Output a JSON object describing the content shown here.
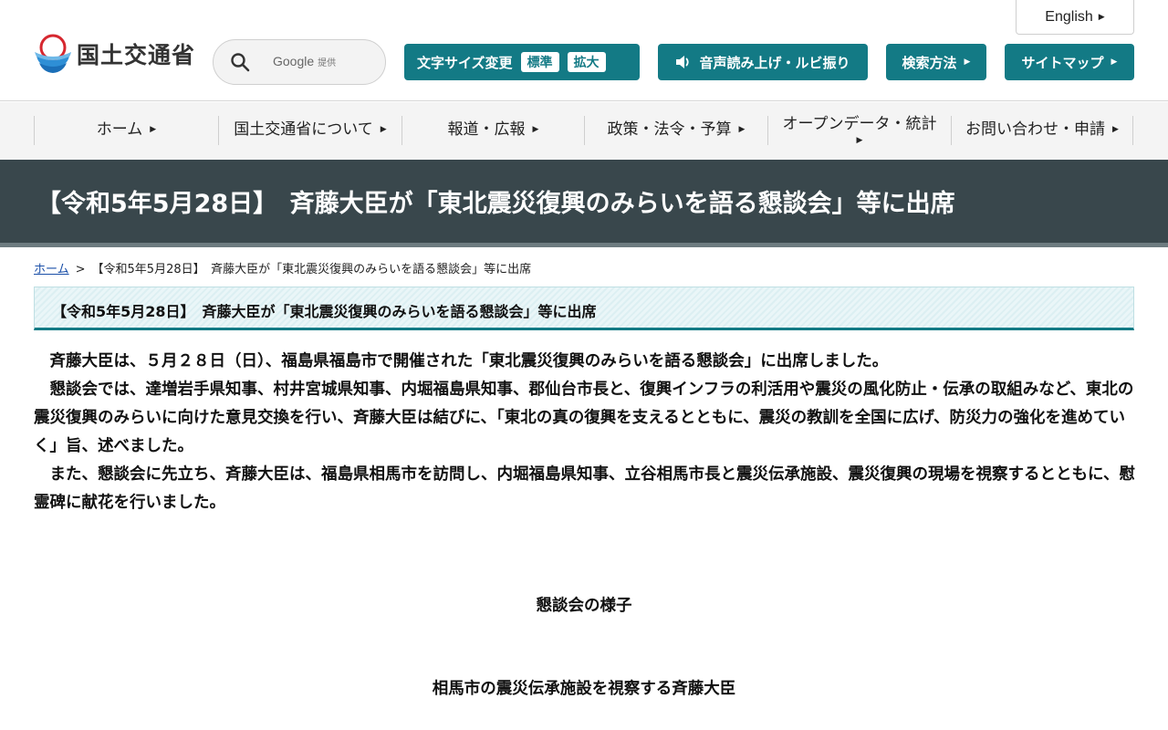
{
  "header": {
    "logo_text": "国土交通省",
    "search": {
      "provider": "Google",
      "provider_suffix": "提供"
    },
    "english_label": "English",
    "font_size": {
      "label": "文字サイズ変更",
      "standard": "標準",
      "large": "拡大"
    },
    "speech_label": "音声読み上げ・ルビ振り",
    "search_method_label": "検索方法",
    "sitemap_label": "サイトマップ"
  },
  "nav": {
    "items": [
      {
        "label": "ホーム"
      },
      {
        "label": "国土交通省について"
      },
      {
        "label": "報道・広報"
      },
      {
        "label": "政策・法令・予算"
      },
      {
        "label": "オープンデータ・統計"
      },
      {
        "label": "お問い合わせ・申請"
      }
    ]
  },
  "page": {
    "title": "【令和5年5月28日】　斉藤大臣が「東北震災復興のみらいを語る懇談会」等に出席"
  },
  "breadcrumb": {
    "home": "ホーム",
    "separator": ">",
    "current": "【令和5年5月28日】　斉藤大臣が「東北震災復興のみらいを語る懇談会」等に出席"
  },
  "content": {
    "heading": "【令和5年5月28日】　斉藤大臣が「東北震災復興のみらいを語る懇談会」等に出席",
    "paragraphs": [
      "斉藤大臣は、５月２８日（日）、福島県福島市で開催された「東北震災復興のみらいを語る懇談会」に出席しました。",
      "懇談会では、達増岩手県知事、村井宮城県知事、内堀福島県知事、郡仙台市長と、復興インフラの利活用や震災の風化防止・伝承の取組みなど、東北の震災復興のみらいに向けた意見交換を行い、斉藤大臣は結びに、「東北の真の復興を支えるとともに、震災の教訓を全国に広げ、防災力の強化を進めていく」旨、述べました。",
      "また、懇談会に先立ち、斉藤大臣は、福島県相馬市を訪問し、内堀福島県知事、立谷相馬市長と震災伝承施設、震災復興の現場を視察するとともに、慰霊碑に献花を行いました。"
    ],
    "caption1": "懇談会の様子",
    "caption2": "相馬市の震災伝承施設を視察する斉藤大臣"
  },
  "colors": {
    "teal": "#137a85",
    "band": "#39474c",
    "nav_bg": "#f4f4f4"
  }
}
